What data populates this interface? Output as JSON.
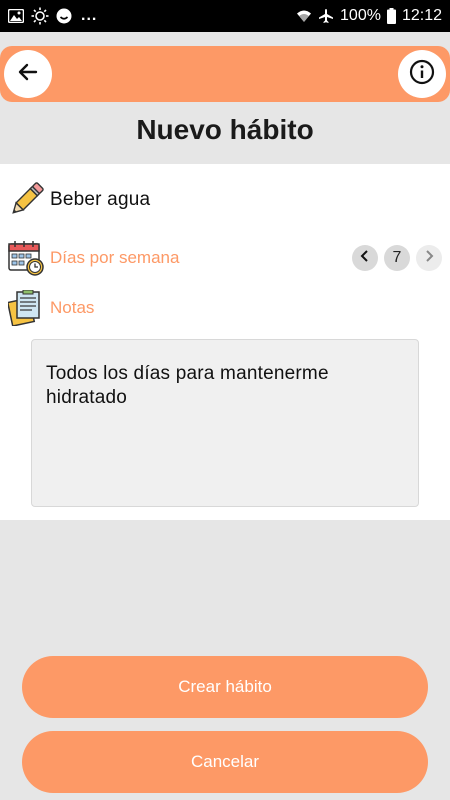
{
  "status_bar": {
    "time": "12:12",
    "battery": "100%",
    "icons": [
      "image-icon",
      "brightness-icon",
      "smiley-icon",
      "wifi-icon",
      "airplane-icon",
      "battery-icon"
    ],
    "more": "..."
  },
  "header": {
    "back_icon": "arrow-left-icon",
    "info_icon": "info-icon",
    "accent": "#fd9966"
  },
  "title": "Nuevo hábito",
  "form": {
    "name": "Beber agua",
    "name_icon": "pencil-icon",
    "days_label": "Días por semana",
    "days_icon": "calendar-clock-icon",
    "days_value": "7",
    "notes_label": "Notas",
    "notes_icon": "notes-icon",
    "notes_text": "Todos los días para mantenerme hidratado"
  },
  "actions": {
    "create_label": "Crear hábito",
    "cancel_label": "Cancelar"
  }
}
